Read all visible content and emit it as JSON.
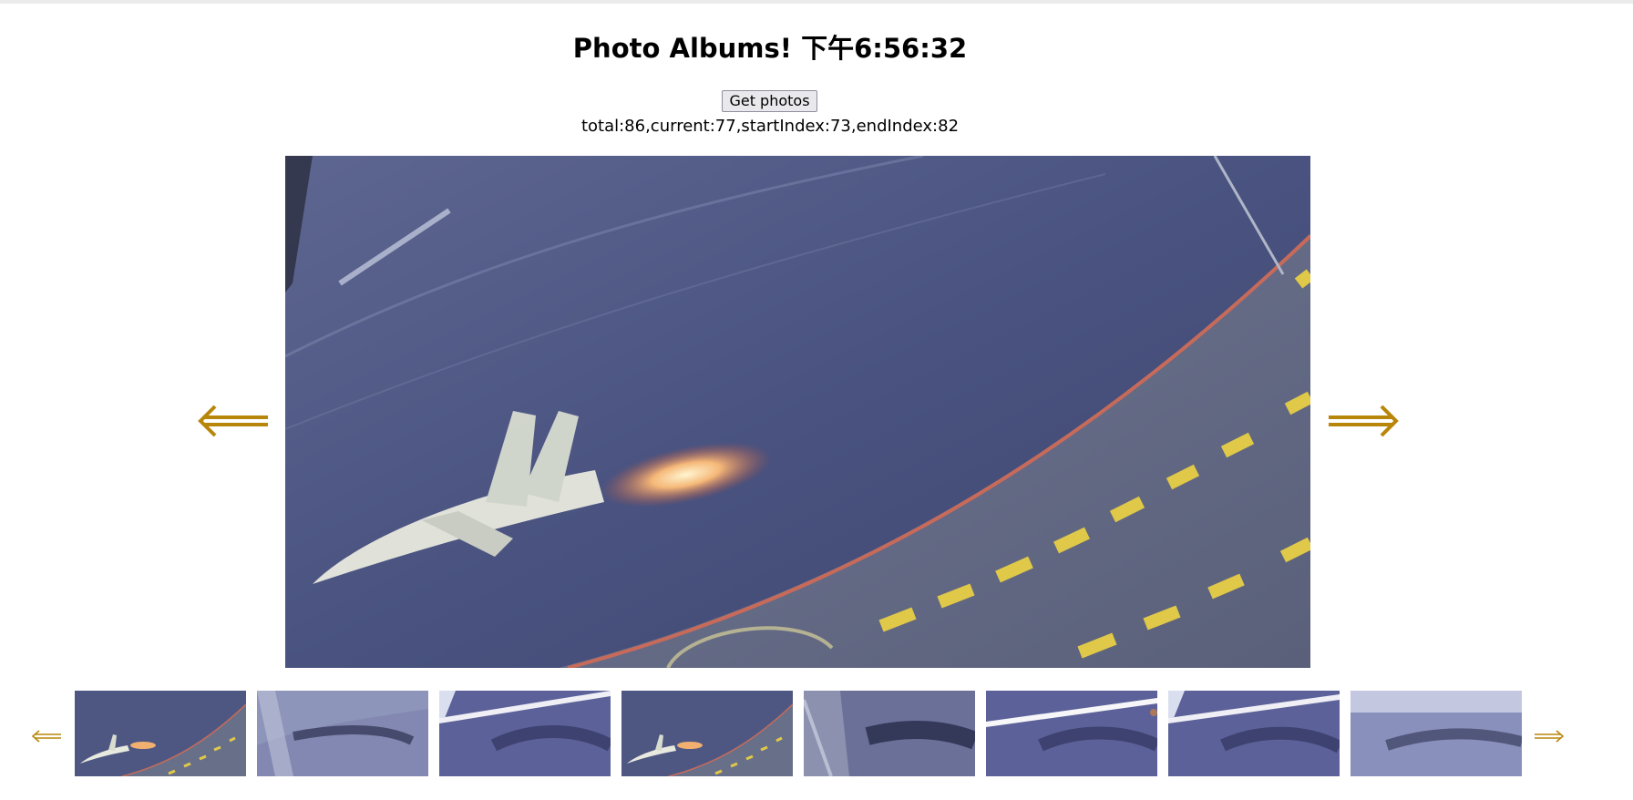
{
  "header": {
    "title": "Photo Albums! 下午6:56:32"
  },
  "controls": {
    "get_photos_label": "Get photos"
  },
  "status": {
    "text": "total:86,current:77,startIndex:73,endIndex:82"
  },
  "gallery": {
    "accent_color": "#b8860b",
    "main_photo_alt": "Jet on carrier deck",
    "thumbnails": [
      {
        "alt": "Jet on carrier deck"
      },
      {
        "alt": "Blurred deck"
      },
      {
        "alt": "Blurred deck with white stripe"
      },
      {
        "alt": "Jet on carrier deck"
      },
      {
        "alt": "Blurred deck with rail"
      },
      {
        "alt": "Blurred deck with white stripe"
      },
      {
        "alt": "Blurred deck with white stripe"
      },
      {
        "alt": "Blurred deck"
      }
    ],
    "icons": {
      "prev": "left-double-arrow-icon",
      "next": "right-double-arrow-icon"
    }
  }
}
